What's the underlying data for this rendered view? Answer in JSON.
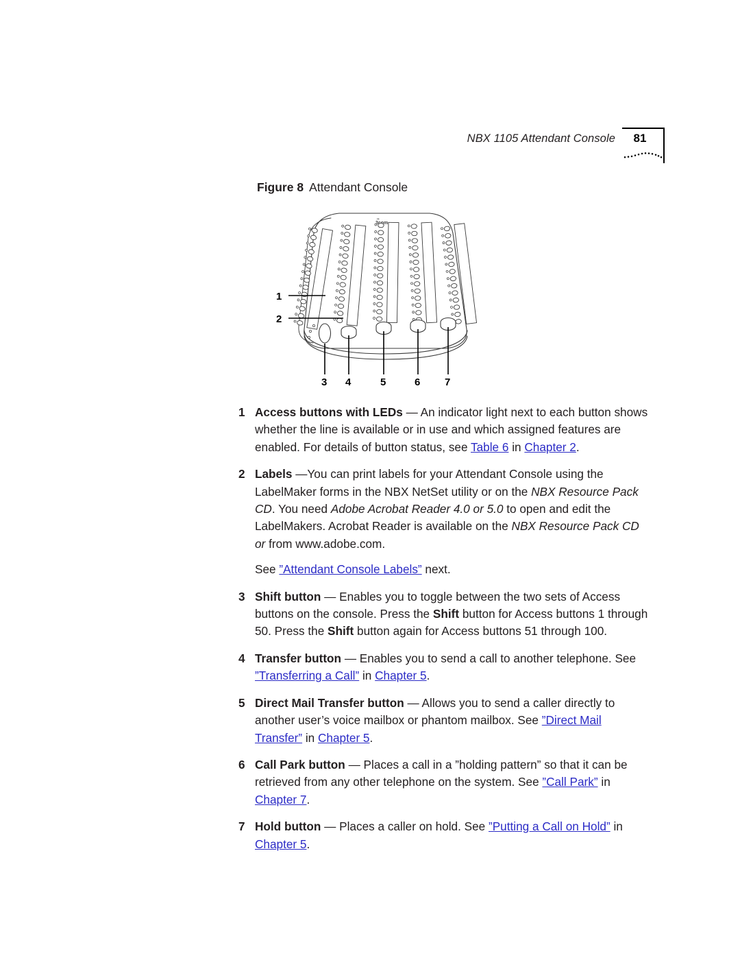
{
  "header": {
    "title": "NBX 1105 Attendant Console",
    "page_number": "81",
    "decoration": "dotted-wave"
  },
  "figure": {
    "label": "Figure 8",
    "caption": "Attendant Console",
    "brand_logo": "3com",
    "callouts": [
      "1",
      "2",
      "3",
      "4",
      "5",
      "6",
      "7"
    ],
    "callout_left": [
      "1",
      "2"
    ],
    "callout_bottom": [
      "3",
      "4",
      "5",
      "6",
      "7"
    ],
    "column_count": 5,
    "buttons_per_column": 14
  },
  "list": {
    "items": [
      {
        "num": "1",
        "title": "Access buttons with LEDs",
        "text_html": "<b>Access buttons with LEDs</b> &mdash; An indicator light next to each button shows whether the line is available or in use and which assigned features are enabled. For details of button status, see <span class=\"lnk\">Table 6</span> in <span class=\"lnk\">Chapter 2</span>."
      },
      {
        "num": "2",
        "title": "Labels",
        "text_html": "<b>Labels</b> &mdash;You can print labels for your Attendant Console using the LabelMaker forms in the NBX NetSet utility or on the <i>NBX Resource Pack CD</i>. You need <i>Adobe Acrobat Reader 4.0 or 5.0</i> to open and edit the LabelMakers. Acrobat Reader is available on the <i>NBX Resource Pack CD or</i> from www.adobe.com."
      },
      {
        "num": "3",
        "title": "Shift button",
        "text_html": "<b>Shift button</b> &mdash; Enables you to toggle between the two sets of Access buttons on the console. Press the <b>Shift</b> button for Access buttons 1 through 50. Press the <b>Shift</b> button again for Access buttons 51 through 100."
      },
      {
        "num": "4",
        "title": "Transfer button",
        "text_html": "<b>Transfer button</b> &mdash; Enables you to send a call to another telephone. See <span class=\"lnk\">&rdquo;Transferring a Call&rdquo;</span> in <span class=\"lnk\">Chapter 5</span>."
      },
      {
        "num": "5",
        "title": "Direct Mail Transfer button",
        "text_html": "<b>Direct Mail Transfer button</b> &mdash; Allows you to send a caller directly to another user&rsquo;s voice mailbox or phantom mailbox. See <span class=\"lnk\">&rdquo;Direct Mail Transfer&rdquo;</span> in <span class=\"lnk\">Chapter 5</span>."
      },
      {
        "num": "6",
        "title": "Call Park button",
        "text_html": "<b>Call Park button</b> &mdash; Places a call in a &rdquo;holding pattern&rdquo; so that it can be retrieved from any other telephone on the system. See <span class=\"lnk\">&rdquo;Call Park&rdquo;</span> in <span class=\"lnk\">Chapter 7</span>."
      },
      {
        "num": "7",
        "title": "Hold button",
        "text_html": "<b>Hold button</b> &mdash; Places a caller on hold. See <span class=\"lnk\">&rdquo;Putting a Call on Hold&rdquo;</span> in <span class=\"lnk\">Chapter 5</span>."
      }
    ],
    "sub_note_html": "See <span class=\"lnk\">&rdquo;Attendant Console Labels&rdquo;</span> next."
  },
  "colors": {
    "text": "#231f20",
    "link": "#2c2cc6",
    "rule": "#000000",
    "page_background": "#ffffff"
  }
}
